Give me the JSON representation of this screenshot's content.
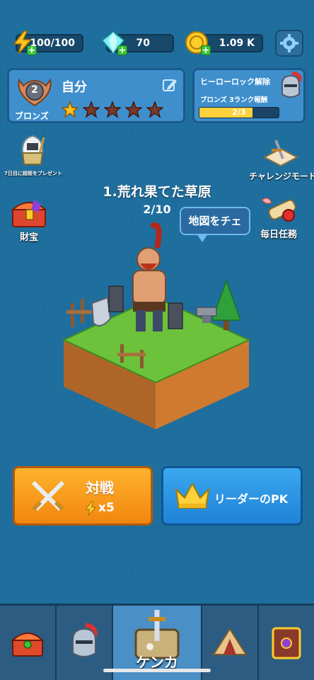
{
  "resources": {
    "energy": "100/100",
    "gems": "70",
    "coins": "1.09 K"
  },
  "player": {
    "name": "自分",
    "rank_level": "2",
    "rank_label": "ブロンズ",
    "stars_total": 5,
    "stars_filled": 1
  },
  "unlock": {
    "title": "ヒーローロック解除",
    "subtitle": "ブロンズ 3ランク報酬",
    "progress_text": "2/3",
    "progress": 0.6667
  },
  "side_menu": {
    "gift_label": "7日目に超姫をプレゼント",
    "treasure_label": "財宝",
    "challenge_label": "チャレンジモード",
    "daily_label": "毎日任務"
  },
  "stage": {
    "title": "1.荒れ果てた草原",
    "progress": "2/10",
    "map_bubble": "地図をチェ"
  },
  "buttons": {
    "battle_label": "対戦",
    "battle_cost": "x5",
    "leader_label": "リーダーのPK"
  },
  "nav": {
    "active_label": "ケンカ"
  },
  "colors": {
    "background": "#1f6f9e",
    "battle_button": "#f79a1c",
    "leader_button": "#2a93e3",
    "progress_fill": "#ffd23b"
  }
}
